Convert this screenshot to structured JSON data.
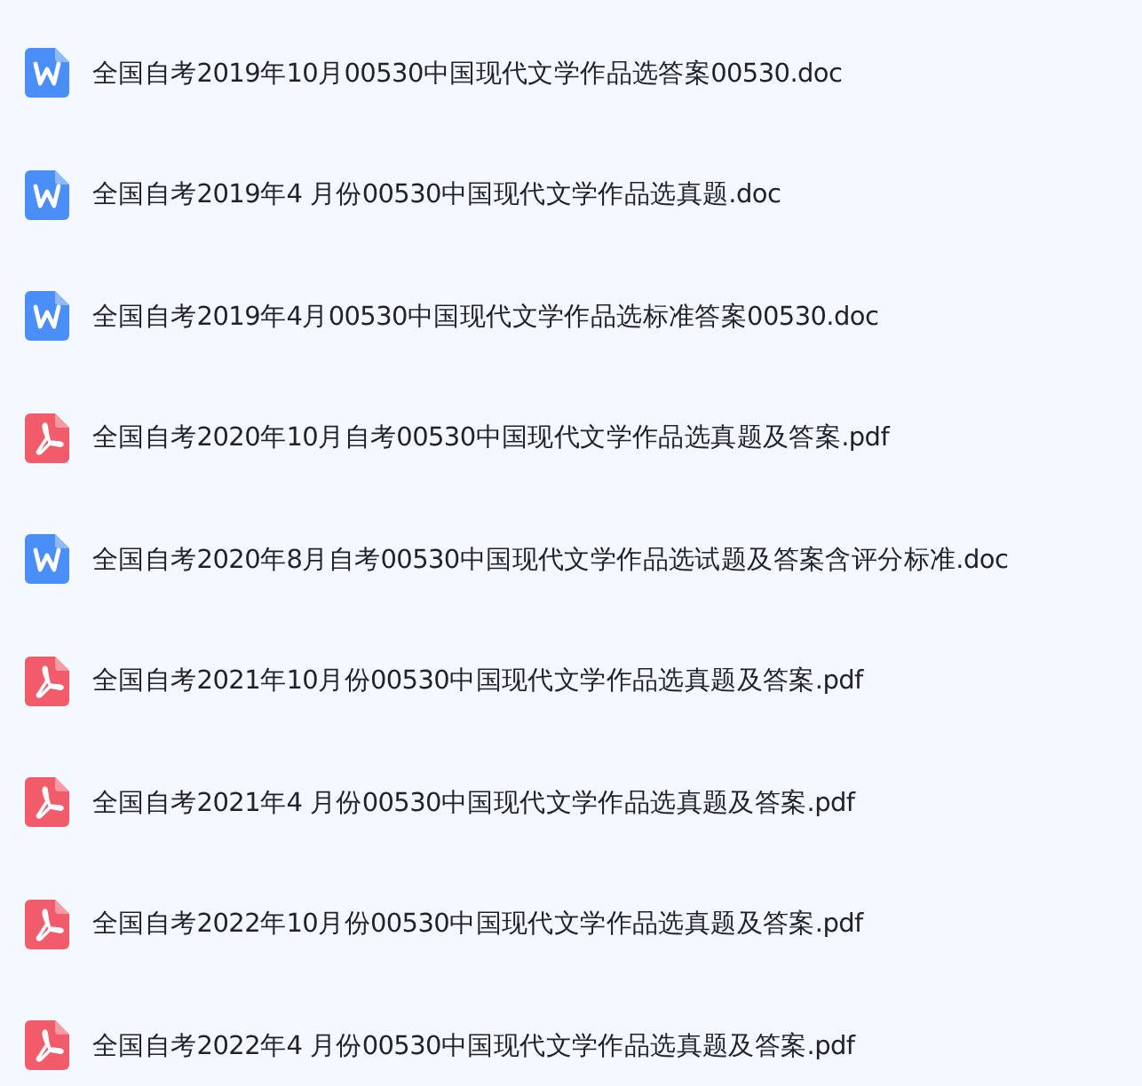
{
  "files": [
    {
      "kind": "doc",
      "name": "全国自考2019年10月00530中国现代文学作品选答案00530.doc"
    },
    {
      "kind": "doc",
      "name": "全国自考2019年4 月份00530中国现代文学作品选真题.doc"
    },
    {
      "kind": "doc",
      "name": "全国自考2019年4月00530中国现代文学作品选标准答案00530.doc"
    },
    {
      "kind": "pdf",
      "name": "全国自考2020年10月自考00530中国现代文学作品选真题及答案.pdf"
    },
    {
      "kind": "doc",
      "name": "全国自考2020年8月自考00530中国现代文学作品选试题及答案含评分标准.doc"
    },
    {
      "kind": "pdf",
      "name": "全国自考2021年10月份00530中国现代文学作品选真题及答案.pdf"
    },
    {
      "kind": "pdf",
      "name": "全国自考2021年4 月份00530中国现代文学作品选真题及答案.pdf"
    },
    {
      "kind": "pdf",
      "name": "全国自考2022年10月份00530中国现代文学作品选真题及答案.pdf"
    },
    {
      "kind": "pdf",
      "name": "全国自考2022年4 月份00530中国现代文学作品选真题及答案.pdf"
    }
  ]
}
